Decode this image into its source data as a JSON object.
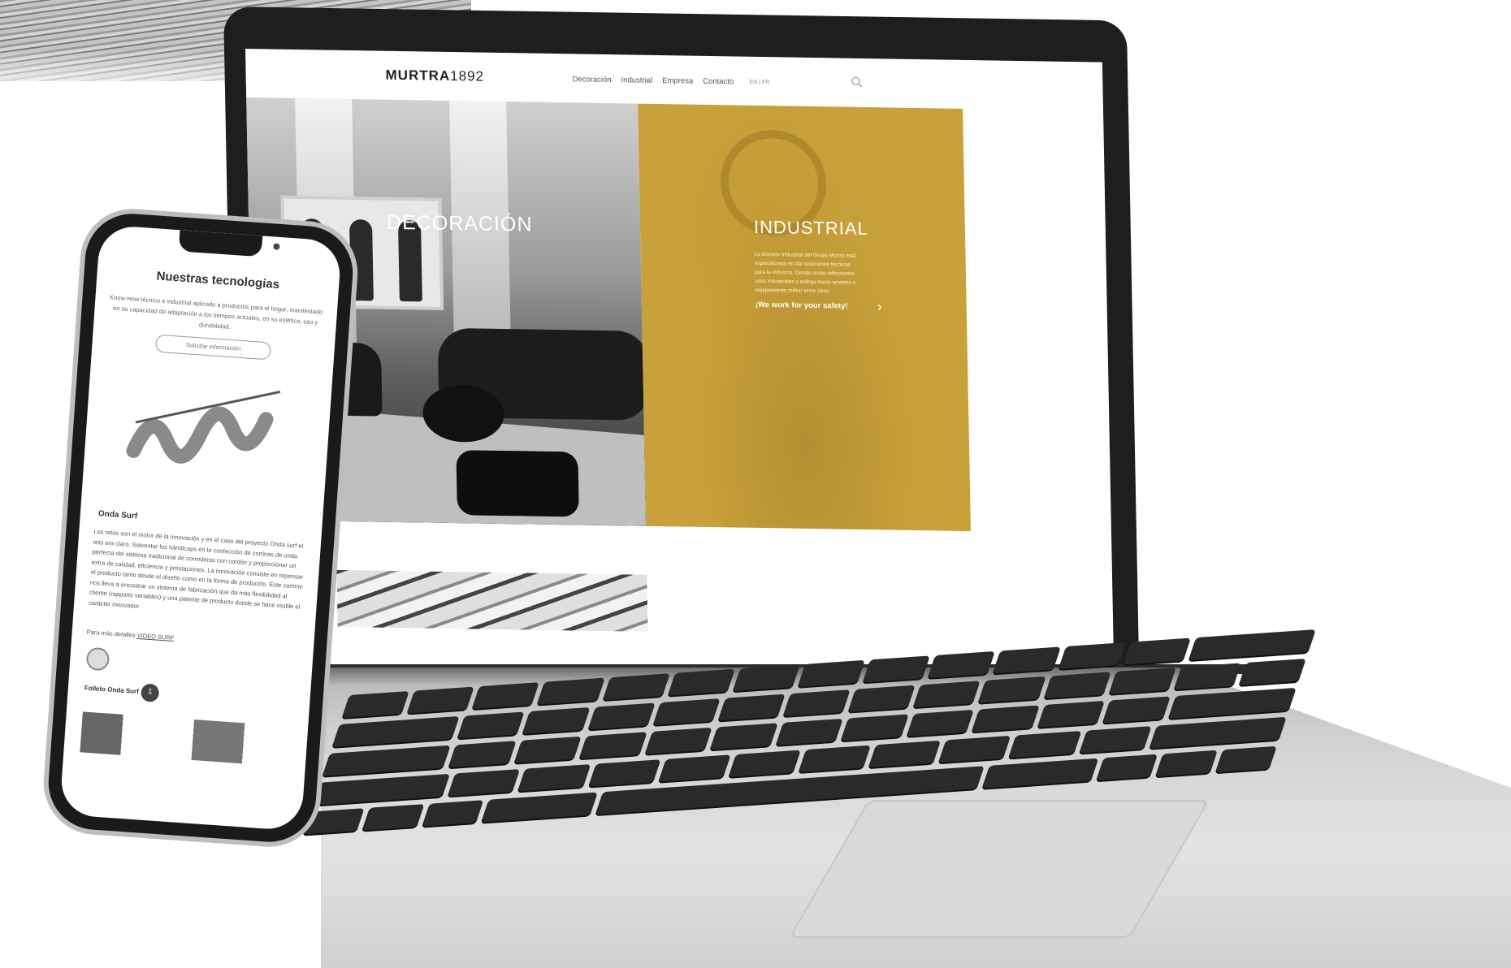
{
  "laptop_site": {
    "logo_bold": "MURTRA",
    "logo_year": "1892",
    "nav": [
      "Decoración",
      "Industrial",
      "Empresa",
      "Contacto"
    ],
    "lang": "EN | FR",
    "hero_left_title": "DECORACIÓN",
    "hero_right_title": "INDUSTRIAL",
    "hero_right_desc": "La División Industrial del Grupo Murtra está especializada en dar soluciones técnicas para la industria. Desde cintas reflectantes usos industriales y eslinga hasta arneses o equipamiento militar entre otros.",
    "hero_right_tagline": "¡We work for your safety!",
    "hero_right_arrow": "›",
    "accent_color": "#c9a13a"
  },
  "phone_site": {
    "title": "Nuestras tecnologías",
    "intro": "Know-How técnico e industrial aplicado a productos para el hogar, manifestado en su capacidad de adaptación a los tiempos actuales, en su estética, uso y durabilidad.",
    "cta": "Solicitar información",
    "section_title": "Onda Surf",
    "body": "Los retos son el motor de la innovación y en el caso del proyecto Onda surf el reto era claro. Solventar los hándicaps en la confección de cortinas de onda perfecta del sistema tradicional de correderas con cordón y proporcionar un extra de calidad, eficiencia y prestaciones. La innovación consiste en repensar el producto tanto desde el diseño como en la forma de producirlo. Este camino nos lleva a encontrar un sistema de fabricación que da más flexibilidad al cliente (rapports variables) y una patente de producto donde se hace visible el carácter innovador.",
    "more_prefix": "Para más detalles",
    "more_link": "VIDEO SURF",
    "brochure": "Folleto Onda Surf",
    "download_icon": "download-icon"
  }
}
